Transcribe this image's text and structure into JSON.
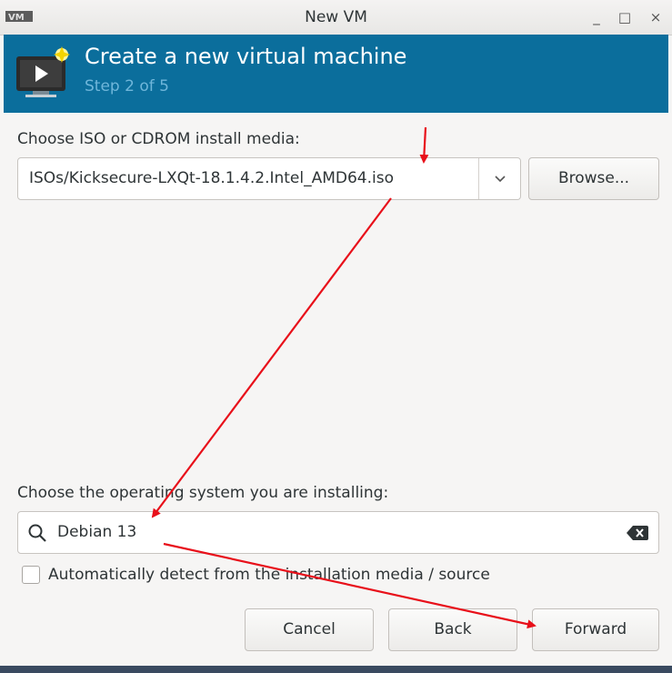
{
  "window": {
    "title": "New VM",
    "minimize_glyph": "_",
    "maximize_glyph": "□",
    "close_glyph": "×"
  },
  "header": {
    "title": "Create a new virtual machine",
    "step": "Step 2 of 5",
    "background_color": "#0b6e9c"
  },
  "install_media": {
    "label": "Choose ISO or CDROM install media:",
    "value": "ISOs/Kicksecure-LXQt-18.1.4.2.Intel_AMD64.iso",
    "browse_label": "Browse..."
  },
  "os_select": {
    "label": "Choose the operating system you are installing:",
    "search_value": "Debian 13",
    "auto_detect_label": "Automatically detect from the installation media / source",
    "auto_detect_checked": false
  },
  "buttons": {
    "cancel": "Cancel",
    "back": "Back",
    "forward": "Forward"
  },
  "annotation_color": "#e8101a"
}
